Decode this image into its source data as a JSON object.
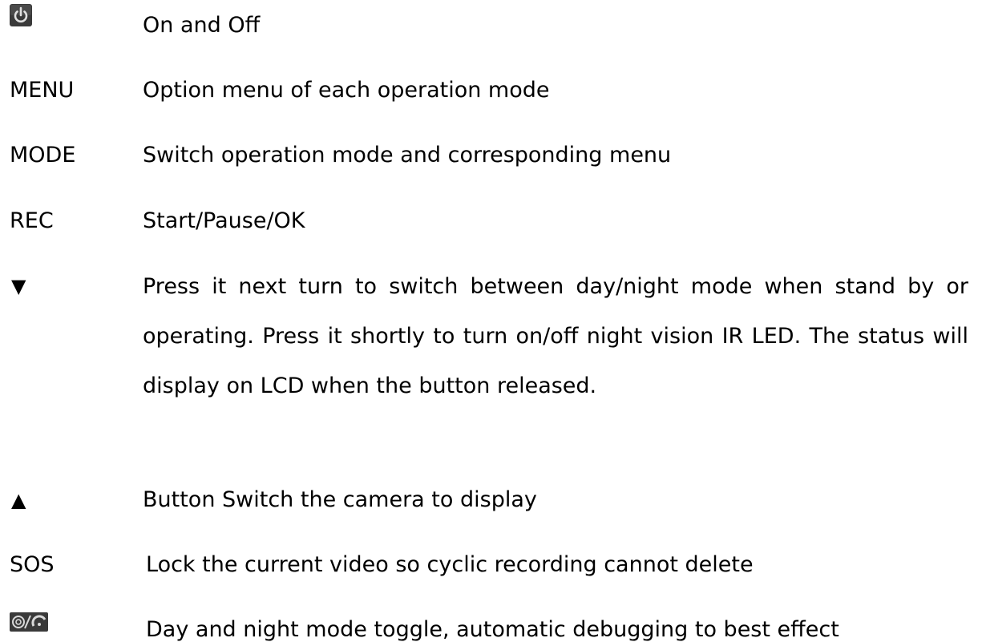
{
  "rows": [
    {
      "key": "",
      "icon": "power-icon",
      "desc": "On and Off"
    },
    {
      "key": "MENU",
      "desc": "Option menu of each operation mode"
    },
    {
      "key": "MODE",
      "desc": "Switch operation mode and corresponding menu"
    },
    {
      "key": "REC",
      "desc": "Start/Pause/OK"
    },
    {
      "key": "▼",
      "desc": "Press it next turn to switch between day/night mode when stand by or operating. Press it shortly to turn on/off night vision IR LED. The status will display on LCD when the button released."
    },
    {
      "key": "▲",
      "desc": "Button Switch the camera to display"
    },
    {
      "key": "SOS",
      "desc": "Lock the current video so cyclic recording cannot delete"
    },
    {
      "key": "",
      "icon": "day-night-toggle-icon",
      "desc": "Day and night mode toggle, automatic debugging to best effect"
    }
  ],
  "colors": {
    "text": "#000000",
    "icon_background": "#3a3a3a",
    "icon_foreground": "#d9d9d9"
  }
}
